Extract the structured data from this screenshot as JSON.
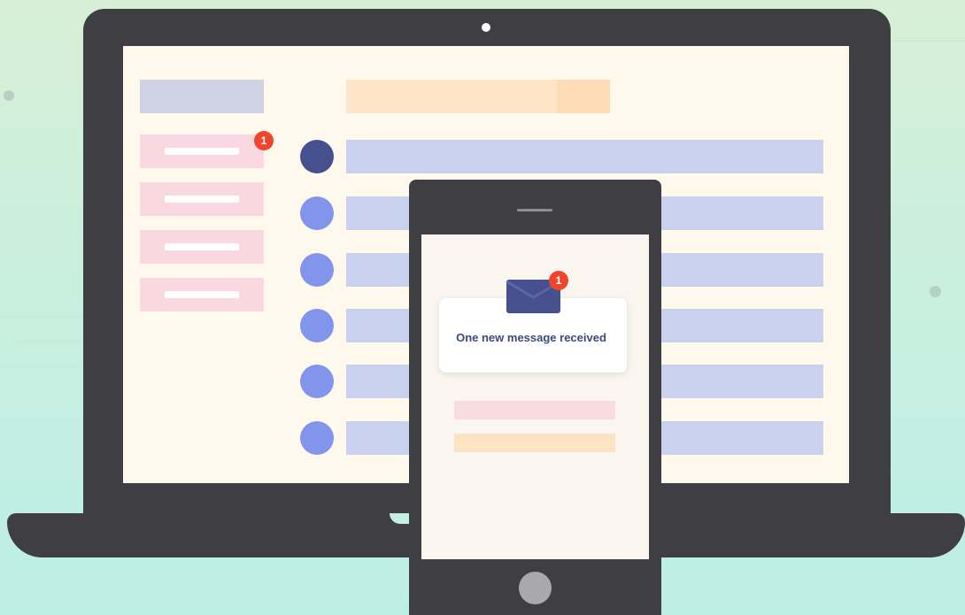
{
  "laptop": {
    "sidebar": {
      "items_count_shown": 4,
      "badge": "1"
    },
    "list": {
      "active_avatar_color": "#46508f",
      "avatar_color": "#8095eb",
      "row_color": "#c8d1ee"
    }
  },
  "phone": {
    "notification": {
      "icon": "envelope-icon",
      "badge": "1",
      "text": "One new message received"
    }
  },
  "colors": {
    "device": "#3f3f43",
    "badge": "#f0452c",
    "envelope": "#46508f"
  }
}
